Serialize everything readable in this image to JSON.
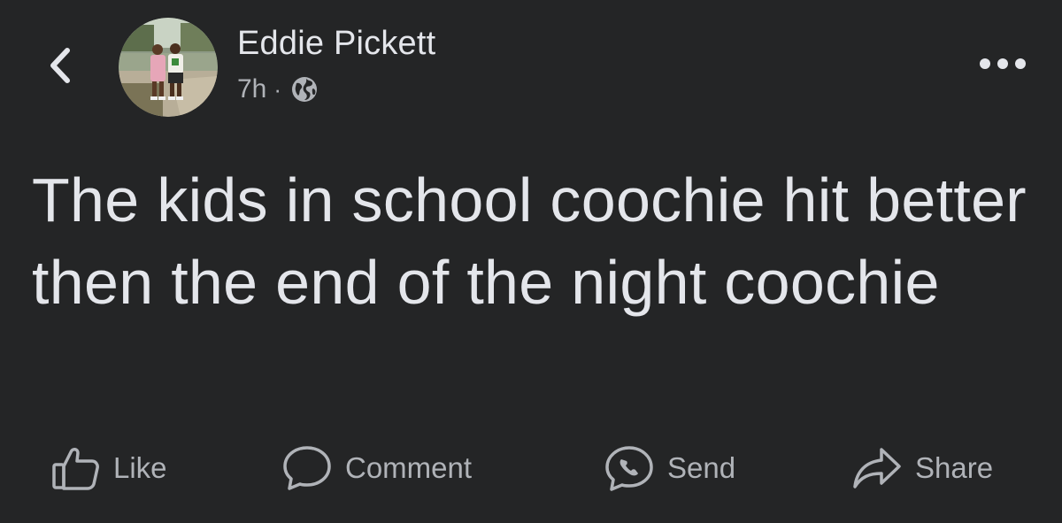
{
  "post": {
    "author_name": "Eddie Pickett",
    "timestamp": "7h",
    "separator": "·",
    "privacy_icon": "globe-icon",
    "text": "The kids in school coochie hit better then the end of the night coochie"
  },
  "header": {
    "back_icon": "chevron-left-icon",
    "more_icon": "more-horizontal-icon"
  },
  "actions": [
    {
      "label": "Like",
      "icon": "thumbs-up-icon"
    },
    {
      "label": "Comment",
      "icon": "comment-bubble-icon"
    },
    {
      "label": "Send",
      "icon": "messenger-send-icon"
    },
    {
      "label": "Share",
      "icon": "share-arrow-icon"
    }
  ],
  "theme": {
    "background": "#242526",
    "primary_text": "#e4e6eb",
    "secondary_text": "#b0b3b8"
  }
}
